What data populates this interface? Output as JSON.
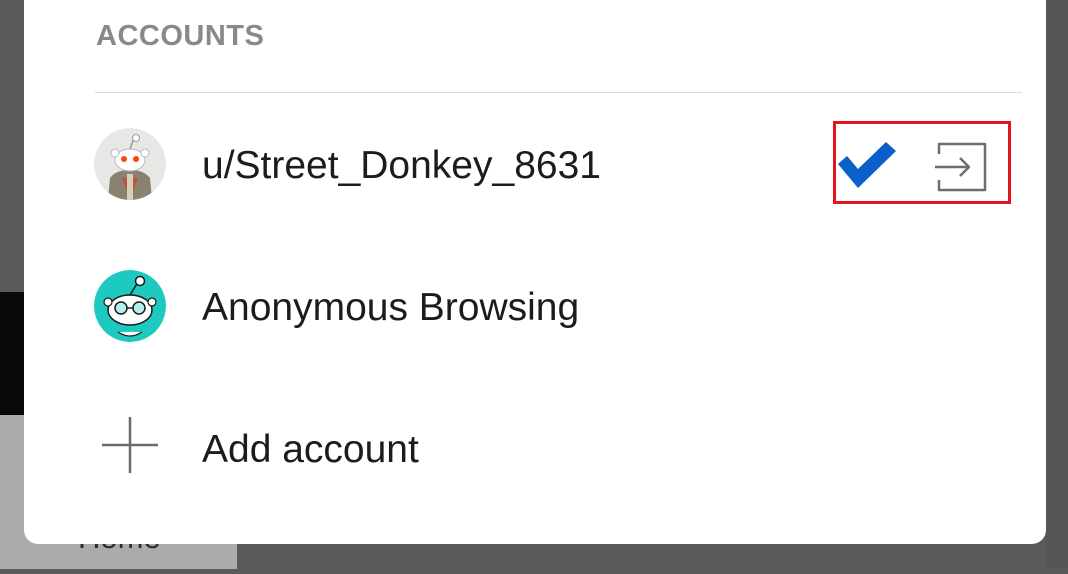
{
  "background": {
    "nav_label": "Home"
  },
  "accounts_sheet": {
    "section_title": "ACCOUNTS",
    "accounts": [
      {
        "label": "u/Street_Donkey_8631",
        "avatar": "user-snoo-avatar",
        "selected": true
      },
      {
        "label": "Anonymous Browsing",
        "avatar": "anonymous-snoo-avatar",
        "selected": false
      }
    ],
    "add_account_label": "Add account",
    "icons": {
      "selected": "checkmark-icon",
      "logout": "logout-icon",
      "add": "plus-icon"
    },
    "colors": {
      "check": "#0a60c8",
      "highlight": "#e2141b",
      "anonymous_avatar_bg": "#1ec9c0"
    }
  }
}
